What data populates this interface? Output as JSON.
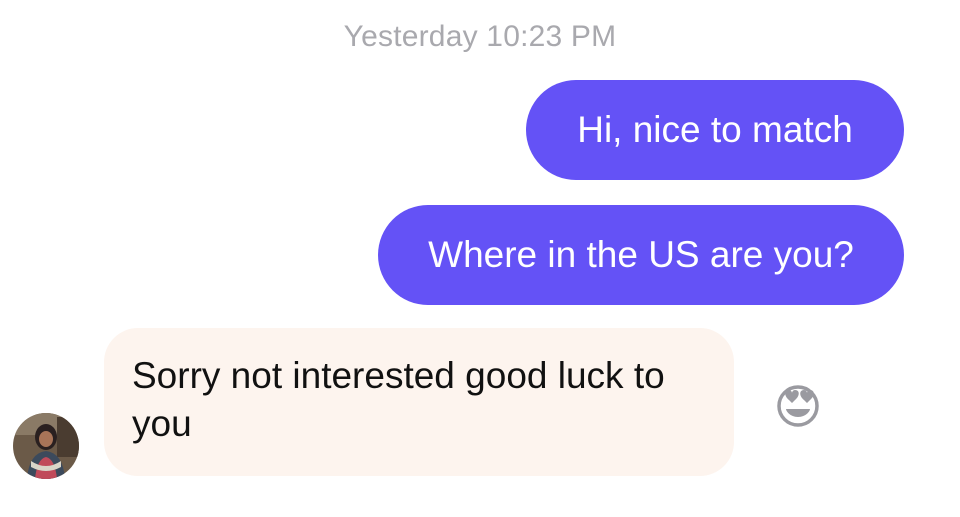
{
  "timestamp": "Yesterday 10:23 PM",
  "messages": [
    {
      "direction": "outgoing",
      "text": "Hi, nice to match"
    },
    {
      "direction": "outgoing",
      "text": "Where in the US are you?"
    },
    {
      "direction": "incoming",
      "text": "Sorry not interested good luck to you"
    }
  ],
  "reaction_icon": "heart-eyes-face-icon",
  "colors": {
    "outgoing_bubble": "#6452f6",
    "incoming_bubble": "#fdf4ee",
    "timestamp": "#a9a9ae"
  }
}
